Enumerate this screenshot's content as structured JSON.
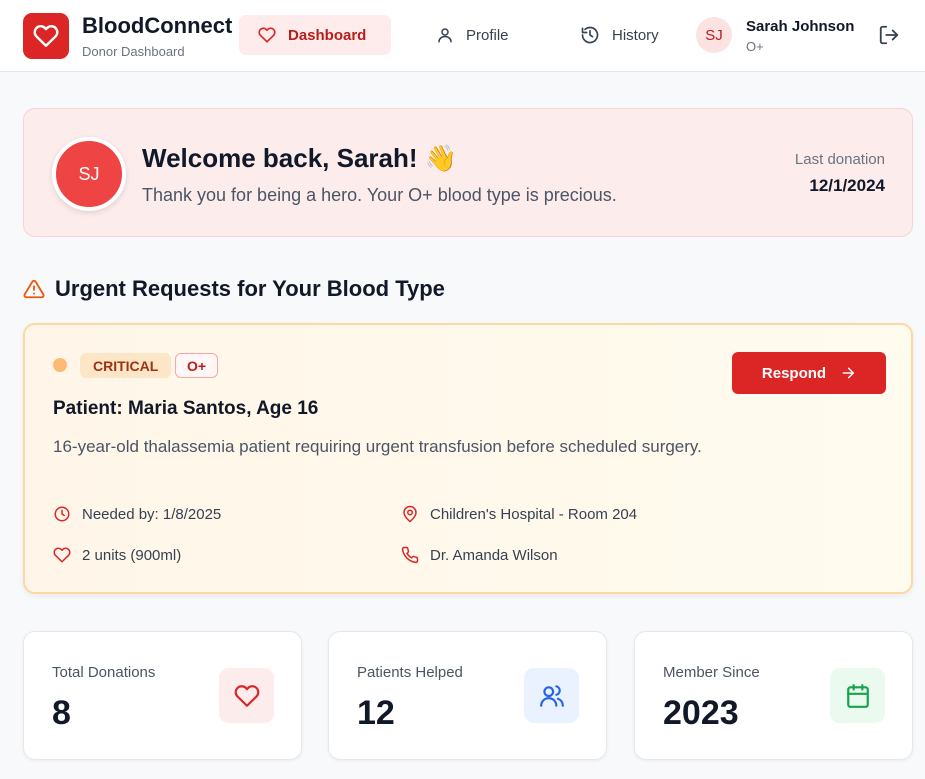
{
  "app": {
    "name": "BloodConnect",
    "subtitle": "Donor Dashboard"
  },
  "nav": {
    "dashboard": "Dashboard",
    "profile": "Profile",
    "history": "History"
  },
  "user": {
    "initials": "SJ",
    "name": "Sarah Johnson",
    "blood_type": "O+"
  },
  "welcome": {
    "title": "Welcome back, Sarah! 👋",
    "subtitle": "Thank you for being a hero. Your O+ blood type is precious.",
    "last_donation_label": "Last donation",
    "last_donation_date": "12/1/2024"
  },
  "urgent": {
    "heading": "Urgent Requests for Your Blood Type",
    "request": {
      "severity": "CRITICAL",
      "blood_type": "O+",
      "respond_label": "Respond",
      "patient": "Patient: Maria Santos, Age 16",
      "description": "16-year-old thalassemia patient requiring urgent transfusion before scheduled surgery.",
      "needed_by": "Needed by: 1/8/2025",
      "location": "Children's Hospital - Room 204",
      "units": "2 units (900ml)",
      "doctor": "Dr. Amanda Wilson"
    }
  },
  "stats": [
    {
      "label": "Total Donations",
      "value": "8",
      "icon": "heart-icon"
    },
    {
      "label": "Patients Helped",
      "value": "12",
      "icon": "users-icon"
    },
    {
      "label": "Member Since",
      "value": "2023",
      "icon": "calendar-icon"
    }
  ],
  "colors": {
    "primary": "#dc2626",
    "warning_border": "#fcd9a0",
    "critical_badge": "#fde6c8",
    "blue_icon": "#2563eb",
    "green_icon": "#16a34a"
  }
}
